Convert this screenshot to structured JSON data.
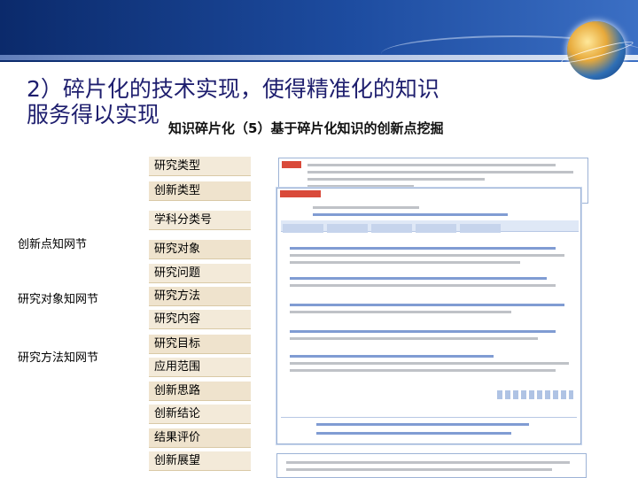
{
  "slide": {
    "title_line1": "2）碎片化的技术实现，使得精准化的知识",
    "title_line2": "服务得以实现",
    "subtitle": "知识碎片化（5）基于碎片化知识的创新点挖掘"
  },
  "left_labels": [
    "创新点知网节",
    "研究对象知网节",
    "研究方法知网节"
  ],
  "categories": [
    "研究类型",
    "创新类型",
    "学科分类号",
    "研究对象",
    "研究问题",
    "研究方法",
    "研究内容",
    "研究目标",
    "应用范围",
    "创新思路",
    "创新结论",
    "结果评价",
    "创新展望"
  ],
  "colors": {
    "title": "#1e1e6e",
    "band_dark": "#0b2a6b",
    "band_light": "#3b6fc4",
    "category_bg": "#f3ead9",
    "accent_red": "#d94a3a",
    "link_blue": "#4a72c0"
  }
}
